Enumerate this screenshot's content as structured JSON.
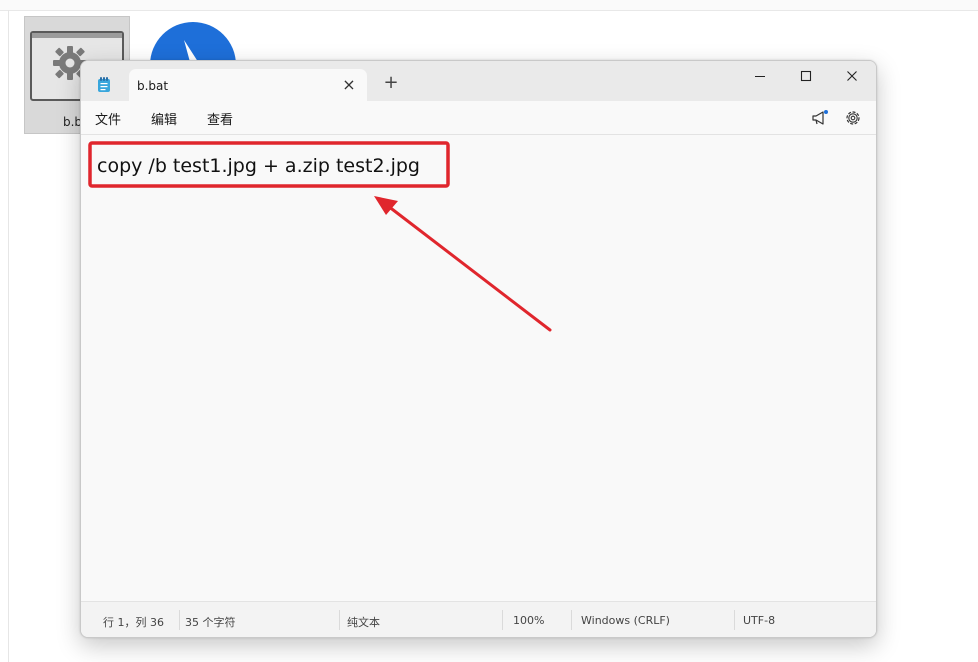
{
  "desktop": {
    "file_label": "b.bat"
  },
  "notepad": {
    "tab_title": "b.bat",
    "new_tab_symbol": "+",
    "close_tab_symbol": "×",
    "menu": {
      "file": "文件",
      "edit": "编辑",
      "view": "查看"
    },
    "content": "copy /b test1.jpg + a.zip test2.jpg",
    "status": {
      "position": "行 1，列 36",
      "char_count": "35 个字符",
      "format": "纯文本",
      "zoom": "100%",
      "line_ending": "Windows (CRLF)",
      "encoding": "UTF-8"
    }
  },
  "icons": {
    "app": "notepad-icon",
    "settings": "gear-icon",
    "copilot": "megaphone-icon"
  },
  "colors": {
    "annotation_red": "#e0262d",
    "app_accent": "#1e6fd9"
  }
}
